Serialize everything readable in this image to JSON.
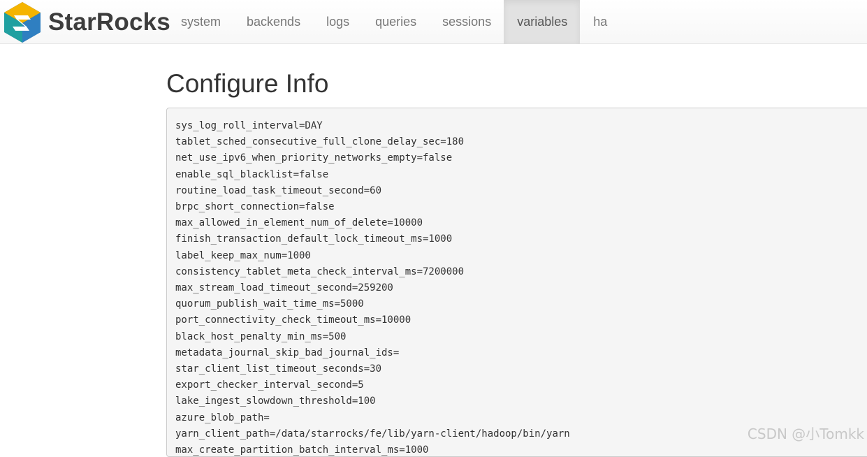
{
  "brand": {
    "name": "StarRocks",
    "logo_icon": "starrocks-logo-icon",
    "colors": {
      "yellow": "#f5b400",
      "blue": "#2f7fc1",
      "teal": "#20a0a0",
      "dark": "#2b4f6e"
    }
  },
  "nav": {
    "items": [
      {
        "label": "system"
      },
      {
        "label": "backends"
      },
      {
        "label": "logs"
      },
      {
        "label": "queries"
      },
      {
        "label": "sessions"
      },
      {
        "label": "variables"
      },
      {
        "label": "ha"
      }
    ],
    "active": "variables"
  },
  "page": {
    "title": "Configure Info"
  },
  "config": {
    "lines": [
      "sys_log_roll_interval=DAY",
      "tablet_sched_consecutive_full_clone_delay_sec=180",
      "net_use_ipv6_when_priority_networks_empty=false",
      "enable_sql_blacklist=false",
      "routine_load_task_timeout_second=60",
      "brpc_short_connection=false",
      "max_allowed_in_element_num_of_delete=10000",
      "finish_transaction_default_lock_timeout_ms=1000",
      "label_keep_max_num=1000",
      "consistency_tablet_meta_check_interval_ms=7200000",
      "max_stream_load_timeout_second=259200",
      "quorum_publish_wait_time_ms=5000",
      "port_connectivity_check_timeout_ms=10000",
      "black_host_penalty_min_ms=500",
      "metadata_journal_skip_bad_journal_ids=",
      "star_client_list_timeout_seconds=30",
      "export_checker_interval_second=5",
      "lake_ingest_slowdown_threshold=100",
      "azure_blob_path=",
      "yarn_client_path=/data/starrocks/fe/lib/yarn-client/hadoop/bin/yarn",
      "max_create_partition_batch_interval_ms=1000"
    ]
  },
  "watermark": "CSDN @小Tomkk"
}
